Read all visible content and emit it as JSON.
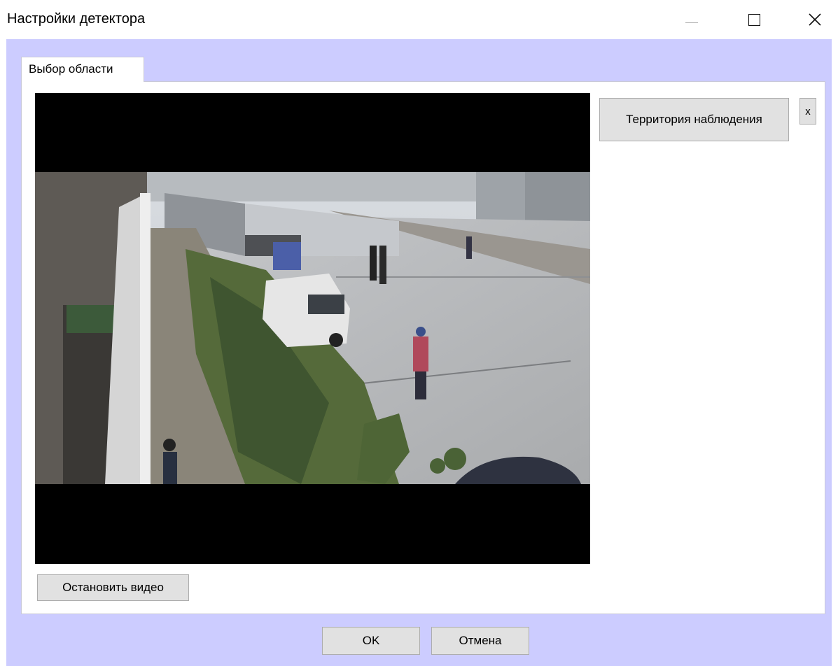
{
  "window": {
    "title": "Настройки детектора",
    "minimize_icon": "minimize-icon",
    "maximize_icon": "maximize-icon",
    "close_icon": "close-icon"
  },
  "tabs": [
    {
      "label": "Выбор области",
      "active": true
    }
  ],
  "zones": {
    "items": [
      {
        "label": "Территория наблюдения"
      }
    ],
    "remove_label": "x"
  },
  "video": {
    "stop_label": "Остановить видео",
    "content": "camera-feed-image"
  },
  "dialog": {
    "ok_label": "OK",
    "cancel_label": "Отмена"
  },
  "colors": {
    "client_background": "#ccccff",
    "button_face": "#e1e1e1",
    "button_border": "#adadad"
  }
}
